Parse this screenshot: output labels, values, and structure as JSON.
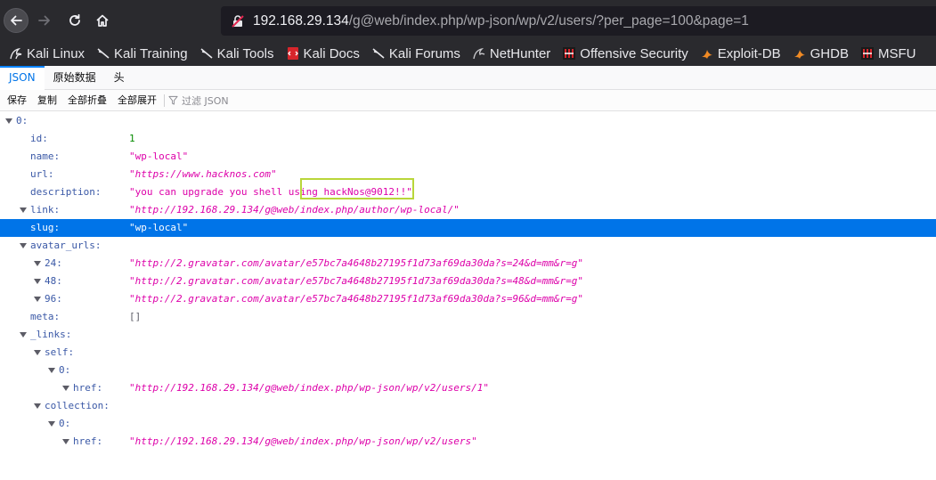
{
  "browser": {
    "url_host": "192.168.29.134",
    "url_path": "/g@web/index.php/wp-json/wp/v2/users/?per_page=100&page=1"
  },
  "bookmarks": [
    {
      "label": "Kali Linux",
      "icon": "kali-dragon-icon"
    },
    {
      "label": "Kali Training",
      "icon": "kali-dragon-icon"
    },
    {
      "label": "Kali Tools",
      "icon": "kali-dragon-icon"
    },
    {
      "label": "Kali Docs",
      "icon": "kali-docs-icon"
    },
    {
      "label": "Kali Forums",
      "icon": "kali-dragon-icon"
    },
    {
      "label": "NetHunter",
      "icon": "nethunter-icon"
    },
    {
      "label": "Offensive Security",
      "icon": "offsec-icon"
    },
    {
      "label": "Exploit-DB",
      "icon": "exploitdb-icon"
    },
    {
      "label": "GHDB",
      "icon": "ghdb-icon"
    },
    {
      "label": "MSFU",
      "icon": "offsec-icon"
    }
  ],
  "viewer": {
    "tabs": [
      "JSON",
      "原始数据",
      "头"
    ],
    "toolbar": {
      "save": "保存",
      "copy": "复制",
      "collapse_all": "全部折叠",
      "expand_all": "全部展开",
      "filter_placeholder": "过滤 JSON"
    }
  },
  "tree": {
    "root_key": "0:",
    "id_key": "id:",
    "id_val": "1",
    "name_key": "name:",
    "name_val": "\"wp-local\"",
    "url_key": "url:",
    "url_val": "\"https://www.hacknos.com\"",
    "desc_key": "description:",
    "desc_val": "\"you can upgrade you shell using hackNos@9012!!\"",
    "link_key": "link:",
    "link_val": "\"http://192.168.29.134/g@web/index.php/author/wp-local/\"",
    "slug_key": "slug:",
    "slug_val": "\"wp-local\"",
    "avatar_key": "avatar_urls:",
    "av24_key": "24:",
    "av24_val": "\"http://2.gravatar.com/avatar/e57bc7a4648b27195f1d73af69da30da?s=24&d=mm&r=g\"",
    "av48_key": "48:",
    "av48_val": "\"http://2.gravatar.com/avatar/e57bc7a4648b27195f1d73af69da30da?s=48&d=mm&r=g\"",
    "av96_key": "96:",
    "av96_val": "\"http://2.gravatar.com/avatar/e57bc7a4648b27195f1d73af69da30da?s=96&d=mm&r=g\"",
    "meta_key": "meta:",
    "meta_val": "[]",
    "links_key": "_links:",
    "self_key": "self:",
    "self0_key": "0:",
    "self_href_key": "href:",
    "self_href_val": "\"http://192.168.29.134/g@web/index.php/wp-json/wp/v2/users/1\"",
    "coll_key": "collection:",
    "coll0_key": "0:",
    "coll_href_key": "href:",
    "coll_href_val": "\"http://192.168.29.134/g@web/index.php/wp-json/wp/v2/users\""
  },
  "colors": {
    "key": "#3a58a6",
    "string": "#dd00a9",
    "number": "#058b00",
    "selection": "#0074e8",
    "annotation_box": "#b9d63a"
  }
}
